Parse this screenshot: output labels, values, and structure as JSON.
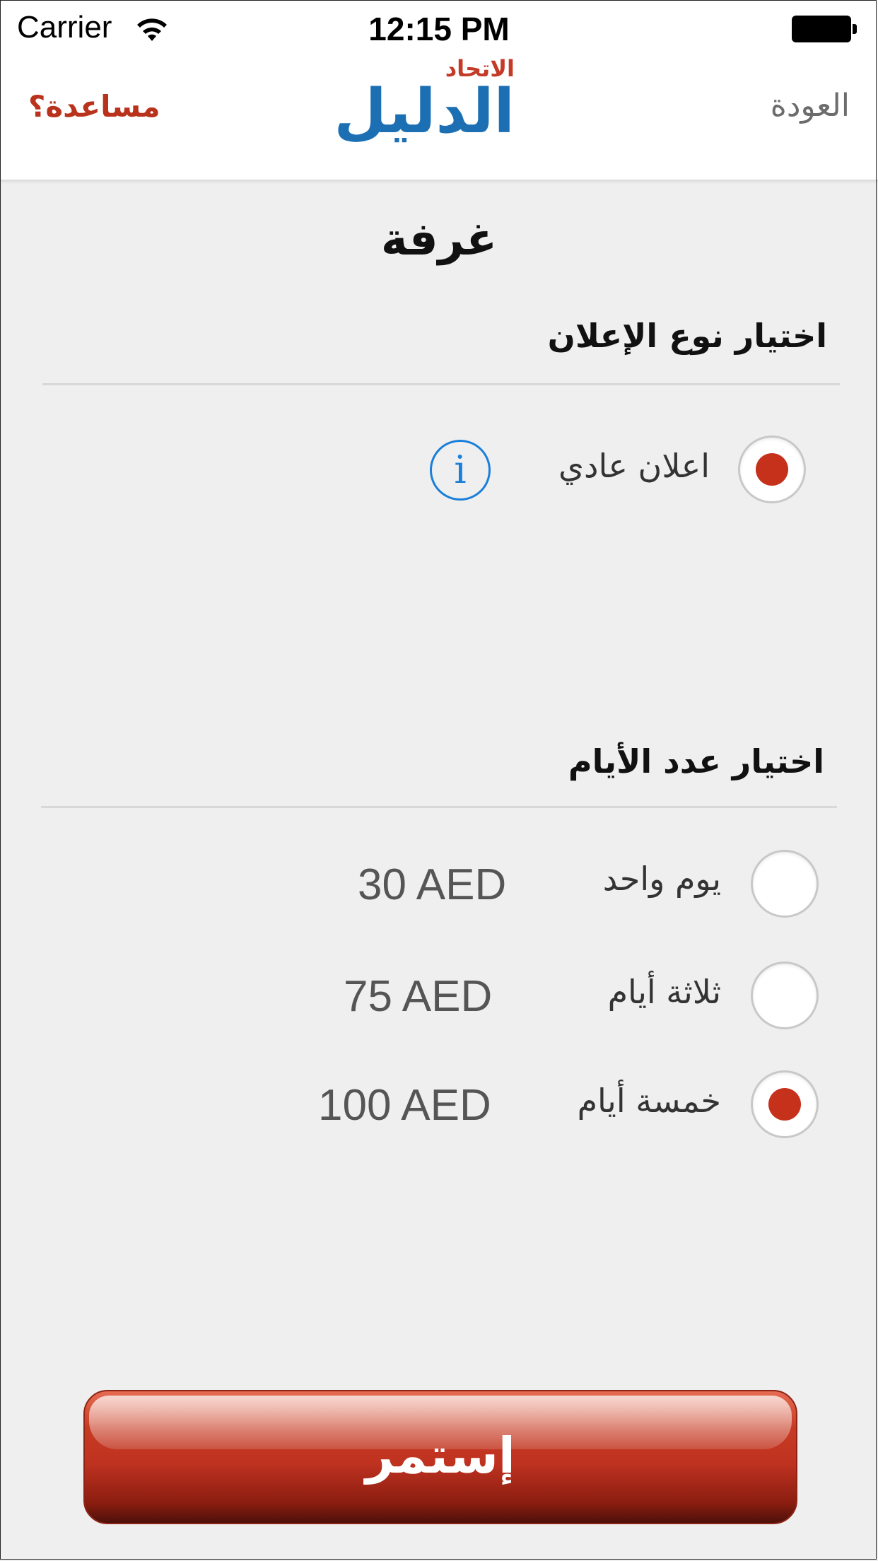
{
  "status_bar": {
    "carrier": "Carrier",
    "time": "12:15 PM"
  },
  "nav": {
    "back_label": "العودة",
    "help_label": "مساعدة؟",
    "logo_small": "الاتحاد",
    "logo_big": "الدليل"
  },
  "page": {
    "title": "غرفة"
  },
  "ad_type": {
    "heading": "اختيار نوع الإعلان",
    "options": [
      {
        "label": "اعلان عادي",
        "selected": true
      }
    ],
    "info_glyph": "i"
  },
  "days": {
    "heading": "اختيار عدد الأيام",
    "options": [
      {
        "label": "يوم واحد",
        "price": "30 AED",
        "selected": false
      },
      {
        "label": "ثلاثة أيام",
        "price": "75 AED",
        "selected": false
      },
      {
        "label": "خمسة أيام",
        "price": "100 AED",
        "selected": true
      }
    ]
  },
  "continue_label": "إستمر",
  "colors": {
    "accent_red": "#c5311a",
    "logo_blue": "#1d6fb3",
    "info_blue": "#1a7fd9"
  }
}
